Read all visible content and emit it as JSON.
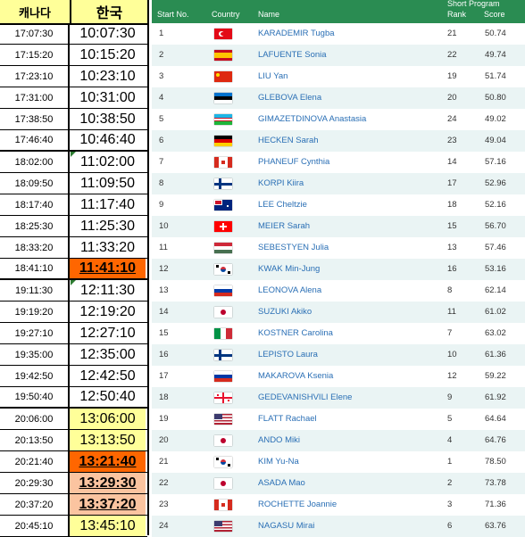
{
  "time_table": {
    "header": {
      "canada": "캐나다",
      "korea": "한국"
    },
    "rows": [
      {
        "ca": "17:07:30",
        "kr": "10:07:30",
        "style": "normal",
        "thick": false
      },
      {
        "ca": "17:15:20",
        "kr": "10:15:20",
        "style": "normal",
        "thick": false
      },
      {
        "ca": "17:23:10",
        "kr": "10:23:10",
        "style": "normal",
        "thick": false
      },
      {
        "ca": "17:31:00",
        "kr": "10:31:00",
        "style": "normal",
        "thick": false
      },
      {
        "ca": "17:38:50",
        "kr": "10:38:50",
        "style": "normal",
        "thick": false
      },
      {
        "ca": "17:46:40",
        "kr": "10:46:40",
        "style": "normal",
        "thick": true
      },
      {
        "ca": "18:02:00",
        "kr": "11:02:00",
        "style": "normal",
        "thick": false,
        "marker": true
      },
      {
        "ca": "18:09:50",
        "kr": "11:09:50",
        "style": "normal",
        "thick": false
      },
      {
        "ca": "18:17:40",
        "kr": "11:17:40",
        "style": "normal",
        "thick": false
      },
      {
        "ca": "18:25:30",
        "kr": "11:25:30",
        "style": "normal",
        "thick": false
      },
      {
        "ca": "18:33:20",
        "kr": "11:33:20",
        "style": "normal",
        "thick": false
      },
      {
        "ca": "18:41:10",
        "kr": "11:41:10",
        "style": "orange",
        "thick": true
      },
      {
        "ca": "19:11:30",
        "kr": "12:11:30",
        "style": "normal",
        "thick": false,
        "marker": true
      },
      {
        "ca": "19:19:20",
        "kr": "12:19:20",
        "style": "normal",
        "thick": false
      },
      {
        "ca": "19:27:10",
        "kr": "12:27:10",
        "style": "normal",
        "thick": false
      },
      {
        "ca": "19:35:00",
        "kr": "12:35:00",
        "style": "normal",
        "thick": false
      },
      {
        "ca": "19:42:50",
        "kr": "12:42:50",
        "style": "normal",
        "thick": false
      },
      {
        "ca": "19:50:40",
        "kr": "12:50:40",
        "style": "normal",
        "thick": true
      },
      {
        "ca": "20:06:00",
        "kr": "13:06:00",
        "style": "yellow",
        "thick": false
      },
      {
        "ca": "20:13:50",
        "kr": "13:13:50",
        "style": "yellow",
        "thick": false
      },
      {
        "ca": "20:21:40",
        "kr": "13:21:40",
        "style": "orange",
        "thick": false
      },
      {
        "ca": "20:29:30",
        "kr": "13:29:30",
        "style": "peach",
        "thick": false
      },
      {
        "ca": "20:37:20",
        "kr": "13:37:20",
        "style": "peach",
        "thick": false
      },
      {
        "ca": "20:45:10",
        "kr": "13:45:10",
        "style": "yellow",
        "thick": false
      }
    ]
  },
  "skate_list": {
    "columns": {
      "start_no": "Start No.",
      "country": "Country",
      "name": "Name",
      "group": "Short Program",
      "rank": "Rank",
      "score": "Score"
    },
    "rows": [
      {
        "no": "1",
        "flag": "TUR",
        "name": "KARADEMIR Tugba",
        "rank": "21",
        "score": "50.74"
      },
      {
        "no": "2",
        "flag": "ESP",
        "name": "LAFUENTE Sonia",
        "rank": "22",
        "score": "49.74"
      },
      {
        "no": "3",
        "flag": "CHN",
        "name": "LIU Yan",
        "rank": "19",
        "score": "51.74"
      },
      {
        "no": "4",
        "flag": "EST",
        "name": "GLEBOVA Elena",
        "rank": "20",
        "score": "50.80"
      },
      {
        "no": "5",
        "flag": "UZB",
        "name": "GIMAZETDINOVA Anastasia",
        "rank": "24",
        "score": "49.02"
      },
      {
        "no": "6",
        "flag": "GER",
        "name": "HECKEN Sarah",
        "rank": "23",
        "score": "49.04"
      },
      {
        "no": "7",
        "flag": "CAN",
        "name": "PHANEUF Cynthia",
        "rank": "14",
        "score": "57.16"
      },
      {
        "no": "8",
        "flag": "FIN",
        "name": "KORPI Kiira",
        "rank": "17",
        "score": "52.96"
      },
      {
        "no": "9",
        "flag": "AUS",
        "name": "LEE Cheltzie",
        "rank": "18",
        "score": "52.16"
      },
      {
        "no": "10",
        "flag": "SUI",
        "name": "MEIER Sarah",
        "rank": "15",
        "score": "56.70"
      },
      {
        "no": "11",
        "flag": "HUN",
        "name": "SEBESTYEN Julia",
        "rank": "13",
        "score": "57.46"
      },
      {
        "no": "12",
        "flag": "KOR",
        "name": "KWAK Min-Jung",
        "rank": "16",
        "score": "53.16"
      },
      {
        "no": "13",
        "flag": "RUS",
        "name": "LEONOVA Alena",
        "rank": "8",
        "score": "62.14"
      },
      {
        "no": "14",
        "flag": "JPN",
        "name": "SUZUKI Akiko",
        "rank": "11",
        "score": "61.02"
      },
      {
        "no": "15",
        "flag": "ITA",
        "name": "KOSTNER Carolina",
        "rank": "7",
        "score": "63.02"
      },
      {
        "no": "16",
        "flag": "FIN",
        "name": "LEPISTO Laura",
        "rank": "10",
        "score": "61.36"
      },
      {
        "no": "17",
        "flag": "RUS",
        "name": "MAKAROVA Ksenia",
        "rank": "12",
        "score": "59.22"
      },
      {
        "no": "18",
        "flag": "GEO",
        "name": "GEDEVANISHVILI Elene",
        "rank": "9",
        "score": "61.92"
      },
      {
        "no": "19",
        "flag": "USA",
        "name": "FLATT Rachael",
        "rank": "5",
        "score": "64.64"
      },
      {
        "no": "20",
        "flag": "JPN",
        "name": "ANDO Miki",
        "rank": "4",
        "score": "64.76"
      },
      {
        "no": "21",
        "flag": "KOR",
        "name": "KIM Yu-Na",
        "rank": "1",
        "score": "78.50"
      },
      {
        "no": "22",
        "flag": "JPN",
        "name": "ASADA Mao",
        "rank": "2",
        "score": "73.78"
      },
      {
        "no": "23",
        "flag": "CAN",
        "name": "ROCHETTE Joannie",
        "rank": "3",
        "score": "71.36"
      },
      {
        "no": "24",
        "flag": "USA",
        "name": "NAGASU Mirai",
        "rank": "6",
        "score": "63.76"
      }
    ]
  },
  "colors": {
    "header_green": "#2a8c52",
    "alt_row": "#eaf4f4",
    "name_link": "#2a6fb5",
    "highlight_yellow": "#ffff99",
    "highlight_orange": "#ff6600",
    "highlight_peach": "#fbc4a0"
  }
}
